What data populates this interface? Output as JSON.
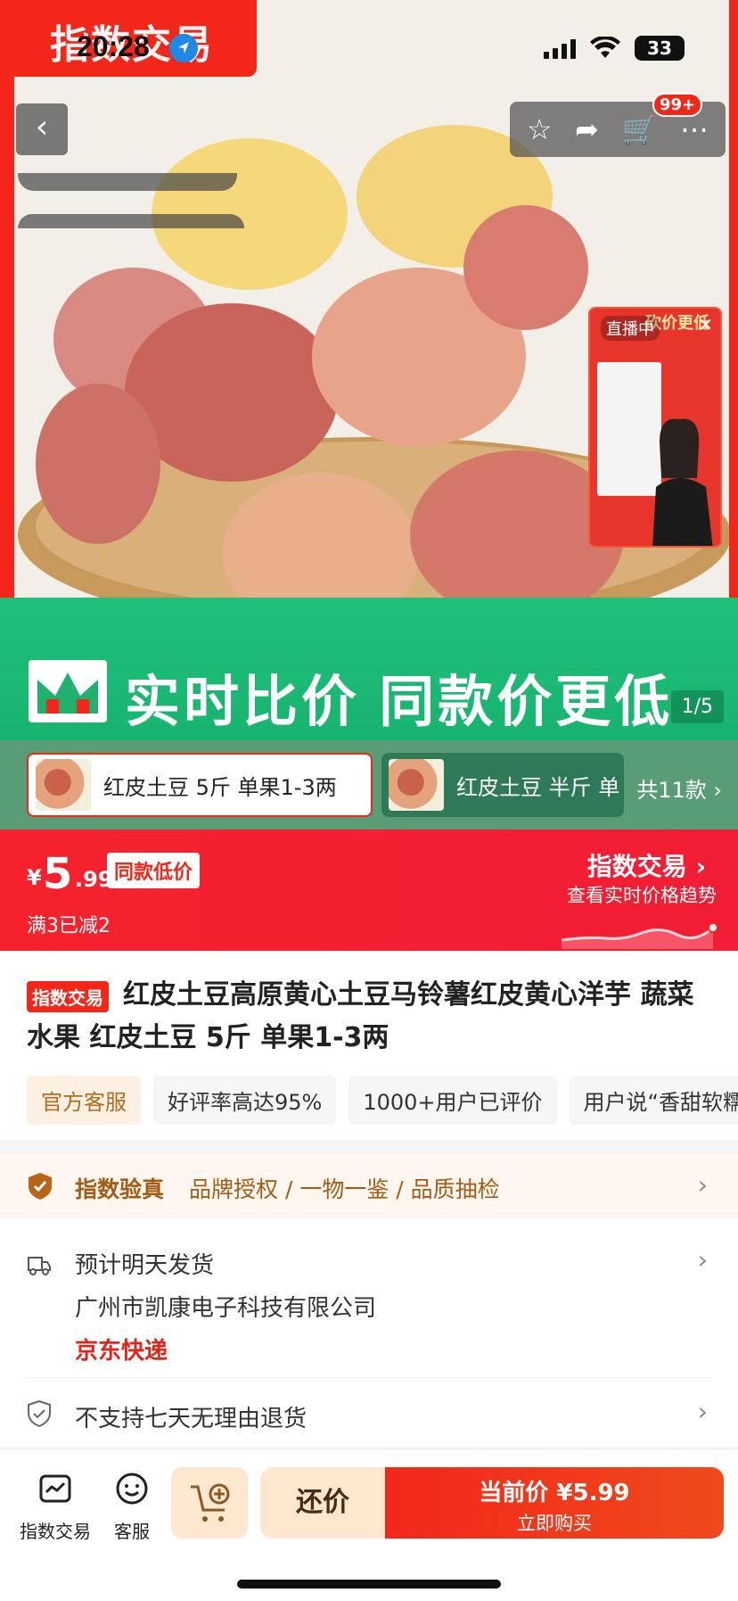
{
  "status_bar": {
    "time": "20:28",
    "battery": "33"
  },
  "brand_tab": "指数交易",
  "header": {
    "back_icon": "chevron-left-icon",
    "actions": [
      "star-icon",
      "share-icon",
      "cart-icon",
      "more-icon"
    ],
    "cart_badge": "99+"
  },
  "live": {
    "tag": "直播中",
    "title": "砍价更低"
  },
  "banner": {
    "text": "实时比价 同款价更低",
    "page_indicator": "1/5"
  },
  "variants": {
    "items": [
      "红皮土豆 5斤 单果1-3两",
      "红皮土豆 半斤 单"
    ],
    "count": "共11款"
  },
  "price": {
    "symbol": "¥",
    "integer": "5",
    "decimal": ".99",
    "tag": "同款低价",
    "promo": "满3已减2",
    "trend_title": "指数交易",
    "trend_sub": "查看实时价格趋势"
  },
  "product": {
    "badge": "指数交易",
    "title": "红皮土豆高原黄心土豆马铃薯红皮黄心洋芋 蔬菜水果 红皮土豆 5斤 单果1-3两",
    "tags": [
      "官方客服",
      "好评率高达95%",
      "1000+用户已评价",
      "用户说“香甜软糯”"
    ]
  },
  "verify": {
    "title": "指数验真",
    "items": "品牌授权 / 一物一鉴 / 品质抽检"
  },
  "shipping": {
    "eta": "预计明天发货",
    "seller": "广州市凯康电子科技有限公司",
    "carrier": "京东快递",
    "returns": "不支持七天无理由退货"
  },
  "bottom_bar": {
    "tab_store": "指数交易",
    "tab_service": "客服",
    "haggle": "还价",
    "buy_price": "当前价 ¥5.99",
    "buy_sub": "立即购买"
  },
  "colors": {
    "brand_red": "#f2271a",
    "green": "#1fc07a",
    "gold": "#a45c14"
  }
}
